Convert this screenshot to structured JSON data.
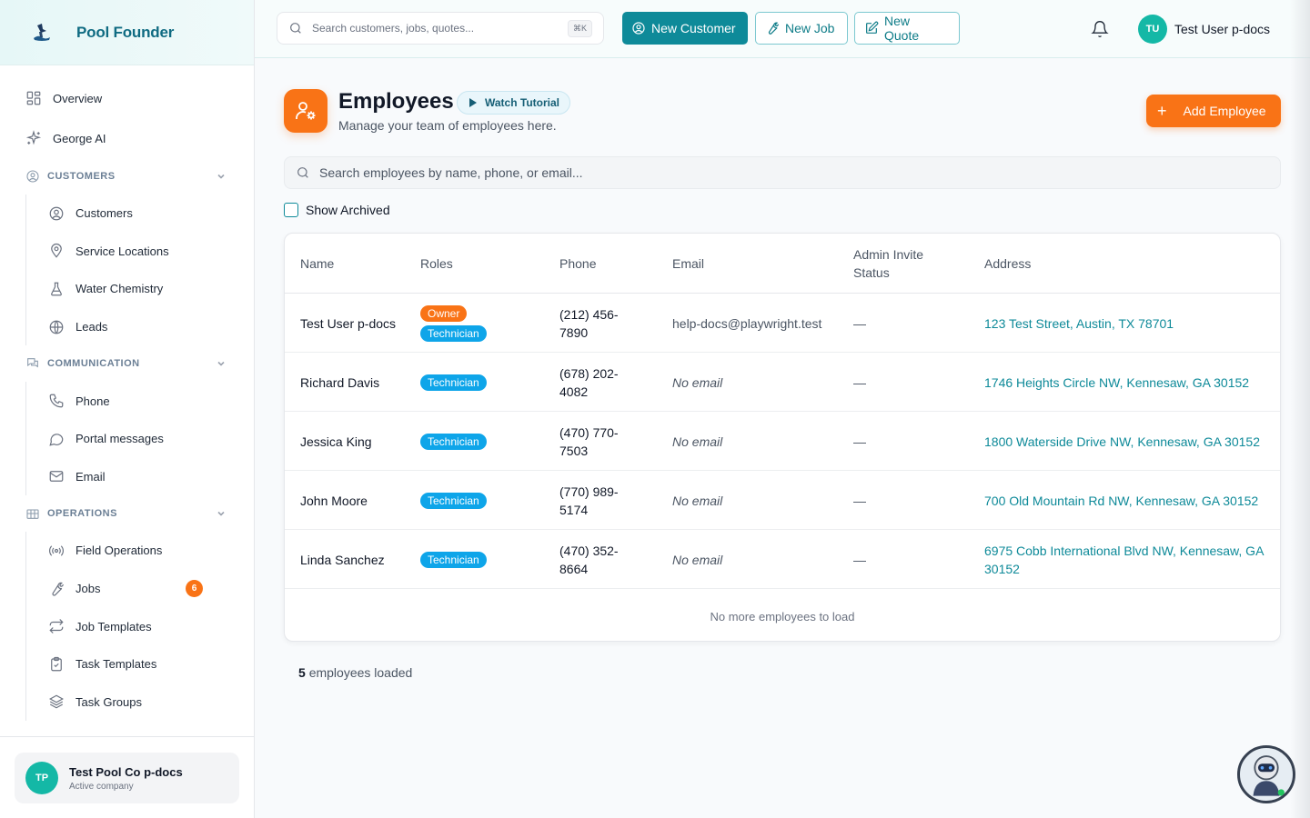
{
  "app": {
    "name": "Pool Founder"
  },
  "sidebar": {
    "top_items": [
      {
        "label": "Overview",
        "icon": "grid-icon"
      },
      {
        "label": "George AI",
        "icon": "sparkles-icon"
      }
    ],
    "sections": [
      {
        "title": "CUSTOMERS",
        "items": [
          {
            "label": "Customers",
            "icon": "user-circle-icon"
          },
          {
            "label": "Service Locations",
            "icon": "map-pin-icon"
          },
          {
            "label": "Water Chemistry",
            "icon": "flask-icon"
          },
          {
            "label": "Leads",
            "icon": "globe-icon"
          }
        ]
      },
      {
        "title": "COMMUNICATION",
        "items": [
          {
            "label": "Phone",
            "icon": "phone-icon"
          },
          {
            "label": "Portal messages",
            "icon": "message-icon"
          },
          {
            "label": "Email",
            "icon": "mail-icon"
          }
        ]
      },
      {
        "title": "OPERATIONS",
        "items": [
          {
            "label": "Field Operations",
            "icon": "radio-icon"
          },
          {
            "label": "Jobs",
            "icon": "wrench-icon",
            "badge": "6"
          },
          {
            "label": "Job Templates",
            "icon": "repeat-icon"
          },
          {
            "label": "Task Templates",
            "icon": "clipboard-check-icon"
          },
          {
            "label": "Task Groups",
            "icon": "layers-icon"
          }
        ]
      }
    ],
    "company": {
      "initials": "TP",
      "name": "Test Pool Co p-docs",
      "status": "Active company"
    }
  },
  "header": {
    "search_placeholder": "Search customers, jobs, quotes...",
    "shortcut": "⌘K",
    "new_customer": "New Customer",
    "new_job": "New Job",
    "new_quote": "New Quote",
    "user": {
      "initials": "TU",
      "name": "Test User p-docs"
    }
  },
  "page": {
    "title": "Employees",
    "tutorial": "Watch Tutorial",
    "subtitle": "Manage your team of employees here.",
    "add_button": "Add Employee",
    "search_placeholder": "Search employees by name, phone, or email...",
    "show_archived": "Show Archived"
  },
  "table": {
    "headers": {
      "name": "Name",
      "roles": "Roles",
      "phone": "Phone",
      "email": "Email",
      "invite": "Admin Invite Status",
      "address": "Address"
    },
    "rows": [
      {
        "name": "Test User p-docs",
        "roles": [
          "Owner",
          "Technician"
        ],
        "phone": "(212) 456-7890",
        "email": "help-docs@playwright.test",
        "invite": "—",
        "address": "123 Test Street, Austin, TX 78701"
      },
      {
        "name": "Richard Davis",
        "roles": [
          "Technician"
        ],
        "phone": "(678) 202-4082",
        "email": "No email",
        "invite": "—",
        "address": "1746 Heights Circle NW, Kennesaw, GA 30152"
      },
      {
        "name": "Jessica King",
        "roles": [
          "Technician"
        ],
        "phone": "(470) 770-7503",
        "email": "No email",
        "invite": "—",
        "address": "1800 Waterside Drive NW, Kennesaw, GA 30152"
      },
      {
        "name": "John Moore",
        "roles": [
          "Technician"
        ],
        "phone": "(770) 989-5174",
        "email": "No email",
        "invite": "—",
        "address": "700 Old Mountain Rd NW, Kennesaw, GA 30152"
      },
      {
        "name": "Linda Sanchez",
        "roles": [
          "Technician"
        ],
        "phone": "(470) 352-8664",
        "email": "No email",
        "invite": "—",
        "address": "6975 Cobb International Blvd NW, Kennesaw, GA 30152"
      }
    ],
    "footer": "No more employees to load"
  },
  "summary": {
    "count": "5",
    "label": "employees loaded"
  },
  "colors": {
    "primary": "#0e8a99",
    "accent": "#f97316",
    "role_technician": "#0ea5e9"
  }
}
